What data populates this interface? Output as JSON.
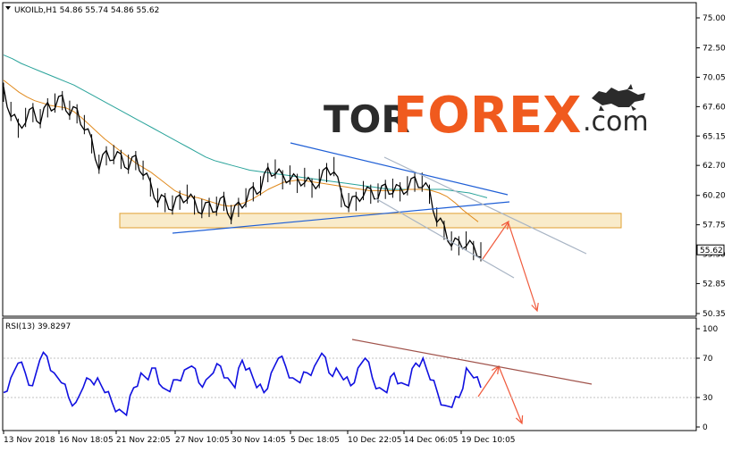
{
  "header": {
    "symbol_info": "UKOILb,H1  54.86 55.74 54.86 55.62",
    "indicator_label": "RSI(13) 39.8297"
  },
  "watermark": {
    "part1": "TOR",
    "part2": "FOREX",
    "part3": ".com"
  },
  "colors": {
    "price": "#000000",
    "ma_fast": "#e08a1e",
    "ma_slow": "#29a39a",
    "trend_blue": "#1f5fd6",
    "channel_grey": "#a8b4c4",
    "zone_fill": "#f6e3b4",
    "zone_stroke": "#e0a030",
    "forecast_red": "#f05a3c",
    "rsi_line": "#1010e0",
    "rsi_trend": "#a0524a",
    "brand_dark": "#2b2b2b",
    "brand_orange": "#f05a1e"
  },
  "chart_data": [
    {
      "type": "line",
      "title": "UKOILb,H1",
      "y_ticks": [
        "75.00",
        "72.50",
        "70.05",
        "67.60",
        "65.15",
        "62.70",
        "60.20",
        "57.75",
        "55.30",
        "52.85",
        "50.35"
      ],
      "ylim": [
        50.35,
        75.0
      ],
      "current_price_label": "55.62",
      "x_ticks": [
        "13 Nov 2018",
        "16 Nov 18:05",
        "21 Nov 22:05",
        "27 Nov 10:05",
        "30 Nov 14:05",
        "5 Dec 18:05",
        "10 Dec 22:05",
        "14 Dec 06:05",
        "19 Dec 10:05"
      ],
      "series": [
        {
          "key": "price",
          "values": [
            68.8,
            67.2,
            65.8,
            66.7,
            67.1,
            66.6,
            67.5,
            67.9,
            68.1,
            67.3,
            67.0,
            66.1,
            64.5,
            62.8,
            63.5,
            63.6,
            63.2,
            62.8,
            63.1,
            62.3,
            60.9,
            60.0,
            59.6,
            59.4,
            59.8,
            60.3,
            59.4,
            59.1,
            59.2,
            59.3,
            59.7,
            58.6,
            59.2,
            60.0,
            60.5,
            61.0,
            62.1,
            62.4,
            61.5,
            61.9,
            61.2,
            61.7,
            60.8,
            61.6,
            62.1,
            62.6,
            60.0,
            59.6,
            59.7,
            60.6,
            60.3,
            60.4,
            60.7,
            60.8,
            60.5,
            61.0,
            61.3,
            61.3,
            60.3,
            58.4,
            57.3,
            56.4,
            56.0,
            56.4,
            55.6,
            55.5
          ],
          "note": "approximate hourly closes, sampled"
        },
        {
          "key": "ma_fast",
          "values": [
            69.8,
            69.3,
            68.8,
            68.4,
            68.1,
            67.9,
            67.7,
            67.6,
            67.5,
            67.2,
            66.7,
            66.1,
            65.5,
            64.9,
            64.4,
            63.9,
            63.4,
            62.9,
            62.5,
            62.1,
            61.6,
            61.1,
            60.6,
            60.3,
            60.1,
            60.0,
            59.8,
            59.6,
            59.4,
            59.3,
            59.4,
            59.6,
            59.9,
            60.3,
            60.7,
            61.0,
            61.3,
            61.4,
            61.5,
            61.4,
            61.3,
            61.2,
            61.1,
            61.0,
            60.9,
            60.8,
            60.7,
            60.6,
            60.6,
            60.6,
            60.6,
            60.6,
            60.7,
            60.7,
            60.7,
            60.6,
            60.4,
            60.1,
            59.6,
            59.0,
            58.5,
            58.0
          ]
        },
        {
          "key": "ma_slow",
          "values": [
            71.9,
            71.6,
            71.2,
            70.9,
            70.6,
            70.3,
            70.0,
            69.7,
            69.4,
            69.0,
            68.6,
            68.2,
            67.8,
            67.4,
            67.0,
            66.6,
            66.2,
            65.8,
            65.4,
            65.0,
            64.6,
            64.2,
            63.8,
            63.4,
            63.1,
            62.9,
            62.7,
            62.5,
            62.3,
            62.2,
            62.1,
            62.0,
            61.9,
            61.8,
            61.7,
            61.6,
            61.5,
            61.4,
            61.3,
            61.2,
            61.1,
            61.0,
            60.9,
            60.8,
            60.7,
            60.7,
            60.7,
            60.7,
            60.7,
            60.7,
            60.7,
            60.6,
            60.5,
            60.4,
            60.2,
            60.0
          ]
        }
      ],
      "annotations": {
        "support_zone": [
          57.5,
          58.7
        ]
      }
    },
    {
      "type": "line",
      "title": "RSI(13) 39.8297",
      "y_ticks": [
        "100",
        "70",
        "30",
        "0"
      ],
      "ylim": [
        0,
        100
      ],
      "series": [
        {
          "key": "rsi",
          "values": [
            35,
            50,
            65,
            55,
            42,
            68,
            72,
            55,
            45,
            30,
            25,
            40,
            48,
            50,
            35,
            25,
            18,
            12,
            40,
            55,
            48,
            60,
            40,
            36,
            48,
            58,
            62,
            45,
            48,
            55,
            62,
            50,
            40,
            68,
            60,
            40,
            35,
            55,
            70,
            62,
            50,
            45,
            55,
            62,
            75,
            55,
            60,
            48,
            42,
            60,
            70,
            50,
            40,
            35,
            55,
            45,
            42,
            65,
            70,
            48,
            35,
            22,
            20,
            30,
            60,
            50,
            40
          ]
        }
      ]
    }
  ]
}
